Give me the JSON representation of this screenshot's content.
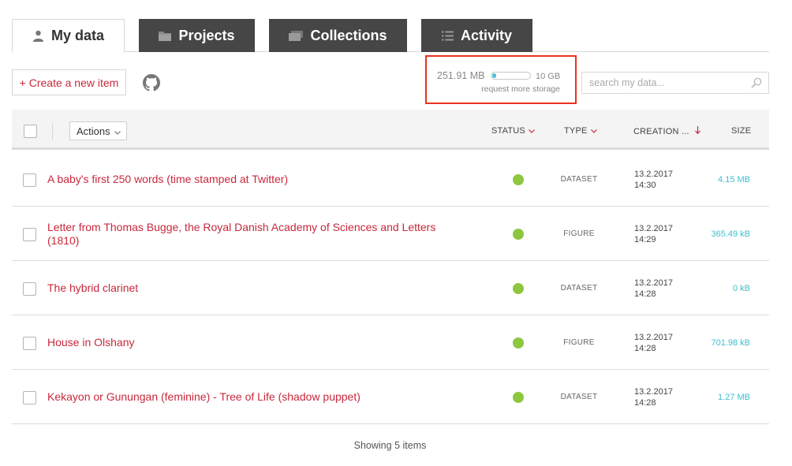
{
  "tabs": [
    {
      "label": "My data",
      "icon": "user-icon"
    },
    {
      "label": "Projects",
      "icon": "folder-icon"
    },
    {
      "label": "Collections",
      "icon": "collections-icon"
    },
    {
      "label": "Activity",
      "icon": "list-icon"
    }
  ],
  "toolbar": {
    "create_label": "+ Create a new item",
    "github_icon": "github-icon"
  },
  "storage": {
    "used": "251.91 MB",
    "total": "10 GB",
    "used_fraction": 0.025,
    "request_label": "request more storage",
    "bar_color": "#4cbfd1"
  },
  "search": {
    "placeholder": "search my data...",
    "value": ""
  },
  "table": {
    "actions_label": "Actions",
    "columns": {
      "status": "STATUS",
      "type": "TYPE",
      "creation": "CREATION ...",
      "size": "SIZE"
    },
    "rows": [
      {
        "title": "A baby's first 250 words (time stamped at Twitter)",
        "type": "DATASET",
        "date": "13.2.2017",
        "time": "14:30",
        "size": "4.15 MB",
        "status_color": "#8dc63f"
      },
      {
        "title": "Letter from Thomas Bugge, the Royal Danish Academy of Sciences and Letters (1810)",
        "type": "FIGURE",
        "date": "13.2.2017",
        "time": "14:29",
        "size": "365.49 kB",
        "status_color": "#8dc63f"
      },
      {
        "title": "The hybrid clarinet",
        "type": "DATASET",
        "date": "13.2.2017",
        "time": "14:28",
        "size": "0 kB",
        "status_color": "#8dc63f"
      },
      {
        "title": "House in Olshany",
        "type": "FIGURE",
        "date": "13.2.2017",
        "time": "14:28",
        "size": "701.98 kB",
        "status_color": "#8dc63f"
      },
      {
        "title": "Kekayon or Gunungan (feminine) - Tree of Life (shadow puppet)",
        "type": "DATASET",
        "date": "13.2.2017",
        "time": "14:28",
        "size": "1.27 MB",
        "status_color": "#8dc63f"
      }
    ]
  },
  "footer": {
    "showing": "Showing 5 items"
  },
  "colors": {
    "accent": "#c8283c",
    "tab_dark": "#464646",
    "size_text": "#3cbfcf",
    "status_ok": "#8dc63f",
    "highlight_border": "#e8331e"
  }
}
